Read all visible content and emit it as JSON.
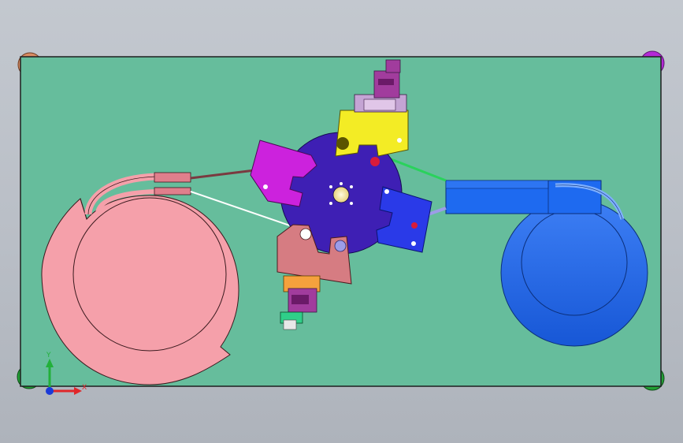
{
  "app": {
    "view": "cad-assembly-top-view"
  },
  "triad": {
    "x_label": "X",
    "y_label": "Y"
  },
  "colors": {
    "background_top": "#c3c8cf",
    "plate": "#66bd9c",
    "plate_edge": "#1e1e1e",
    "pink_reel": "#f5a0aa",
    "blue_reel": "#1e6af0",
    "indexing_disc": "#3e1fb4",
    "magenta_arm": "#cc22dd",
    "blue_arm": "#2a3ae8",
    "pink_arm": "#d67c82",
    "yellow_bracket": "#f3ec25",
    "cylinder_purple": "#a13c9d",
    "corner_orange": "#d98c63",
    "corner_purple": "#b329d6",
    "corner_green": "#22a035"
  },
  "icons": [
    "axis-triad-icon",
    "corner-foot-icon"
  ]
}
